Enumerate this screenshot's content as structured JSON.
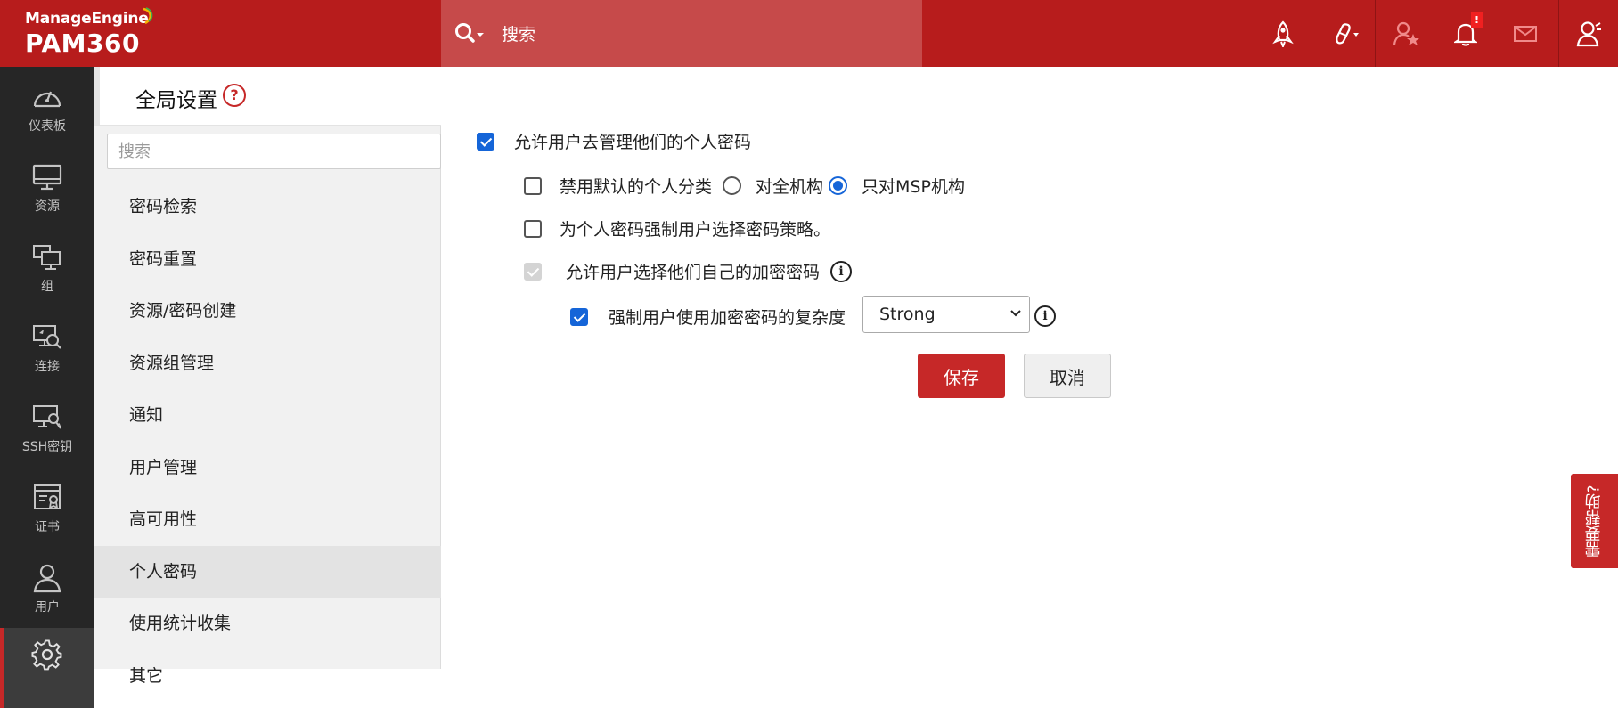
{
  "header": {
    "brand": "ManageEngine",
    "product": "PAM360",
    "search_placeholder": "搜索",
    "notification_badge": "!"
  },
  "leftnav": {
    "items": [
      {
        "label": "仪表板",
        "icon": "dashboard-icon"
      },
      {
        "label": "资源",
        "icon": "monitor-icon"
      },
      {
        "label": "组",
        "icon": "group-icon"
      },
      {
        "label": "连接",
        "icon": "connection-icon"
      },
      {
        "label": "SSH密钥",
        "icon": "ssh-key-icon"
      },
      {
        "label": "证书",
        "icon": "certificate-icon"
      },
      {
        "label": "用户",
        "icon": "user-icon"
      },
      {
        "label": "",
        "icon": "gear-icon",
        "active": true
      }
    ]
  },
  "settings": {
    "title": "全局设置",
    "search_placeholder": "搜索",
    "items": [
      {
        "label": "密码检索"
      },
      {
        "label": "密码重置"
      },
      {
        "label": "资源/密码创建"
      },
      {
        "label": "资源组管理"
      },
      {
        "label": "通知"
      },
      {
        "label": "用户管理"
      },
      {
        "label": "高可用性"
      },
      {
        "label": "个人密码",
        "active": true
      },
      {
        "label": "使用统计收集"
      },
      {
        "label": "其它"
      }
    ]
  },
  "main": {
    "allow_personal": {
      "label": "允许用户去管理他们的个人密码",
      "checked": true
    },
    "disable_default": {
      "label": "禁用默认的个人分类",
      "checked": false
    },
    "radio_all": {
      "label": "对全机构",
      "checked": false
    },
    "radio_msp": {
      "label": "只对MSP机构",
      "checked": true
    },
    "enforce_policy": {
      "label": "为个人密码强制用户选择密码策略。",
      "checked": false
    },
    "allow_own_key": {
      "label": "允许用户选择他们自己的加密密码",
      "checked": true,
      "disabled": true
    },
    "enforce_complexity": {
      "label": "强制用户使用加密密码的复杂度",
      "checked": true
    },
    "complexity_select": {
      "value": "Strong"
    },
    "save_label": "保存",
    "cancel_label": "取消"
  },
  "feedback_label": "需要帮助?"
}
